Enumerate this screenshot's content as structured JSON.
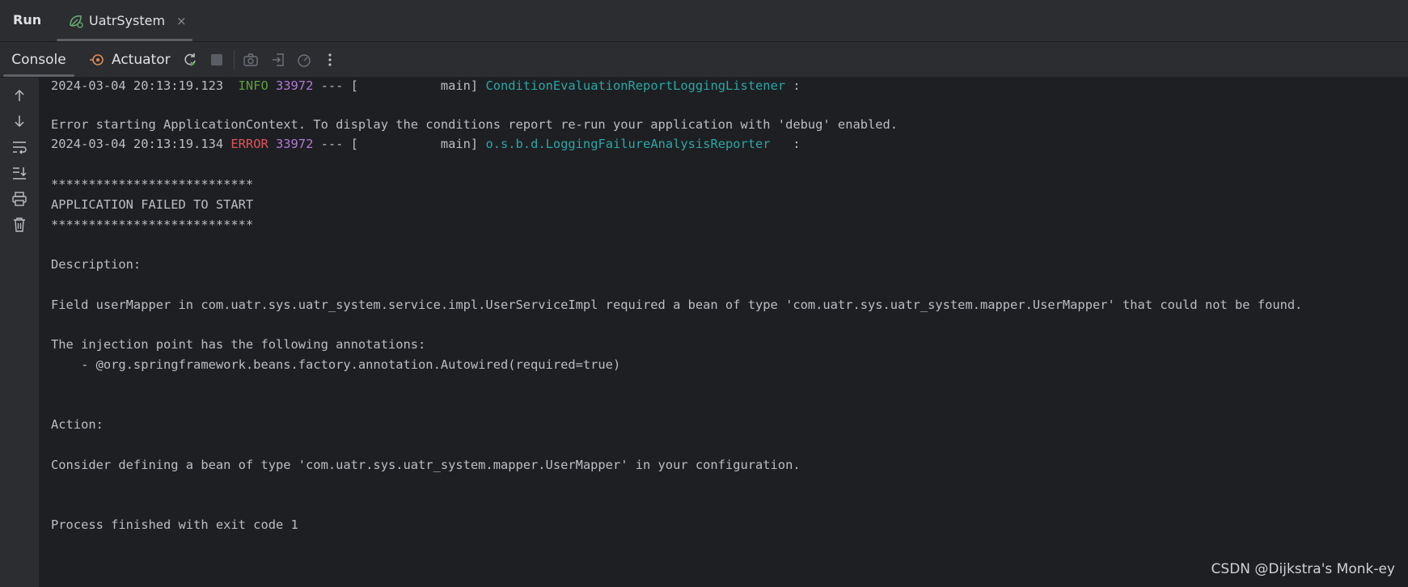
{
  "header": {
    "run_label": "Run",
    "tab_title": "UatrSystem",
    "tab_close": "×"
  },
  "toolbar": {
    "console_label": "Console",
    "actuator_label": "Actuator",
    "icons": [
      "rerun-icon",
      "stop-icon",
      "camera-icon",
      "exit-icon",
      "gauge-icon",
      "more-vert-icon"
    ]
  },
  "gutter": {
    "icons": [
      "arrow-up-icon",
      "arrow-down-icon",
      "soft-wrap-icon",
      "scroll-to-end-icon",
      "print-icon",
      "trash-icon"
    ]
  },
  "console": {
    "line1": {
      "ts": "2024-03-04 20:13:19.123  ",
      "level": "INFO",
      "pid": " 33972",
      "mid": " --- [           main] ",
      "logger": "ConditionEvaluationReportLoggingListener",
      "tail": " :"
    },
    "line2": "Error starting ApplicationContext. To display the conditions report re-run your application with 'debug' enabled.",
    "line3": {
      "ts": "2024-03-04 20:13:19.134 ",
      "level": "ERROR",
      "pid": " 33972",
      "mid": " --- [           main] ",
      "logger": "o.s.b.d.LoggingFailureAnalysisReporter",
      "tail": "   :"
    },
    "stars1": "***************************",
    "app_failed": "APPLICATION FAILED TO START",
    "stars2": "***************************",
    "description": "Description:",
    "field_msg": "Field userMapper in com.uatr.sys.uatr_system.service.impl.UserServiceImpl required a bean of type 'com.uatr.sys.uatr_system.mapper.UserMapper' that could not be found.",
    "injection": "The injection point has the following annotations:",
    "autowired": "    - @org.springframework.beans.factory.annotation.Autowired(required=true)",
    "action": "Action:",
    "consider": "Consider defining a bean of type 'com.uatr.sys.uatr_system.mapper.UserMapper' in your configuration.",
    "process": "Process finished with exit code 1"
  },
  "watermark": "CSDN @Dijkstra's Monk-ey",
  "colors": {
    "background": "#1e1f22",
    "panel": "#2b2d30",
    "info": "#5fa03c",
    "error": "#e0545b",
    "pid": "#b07ad6",
    "logger": "#2aa7a7"
  }
}
